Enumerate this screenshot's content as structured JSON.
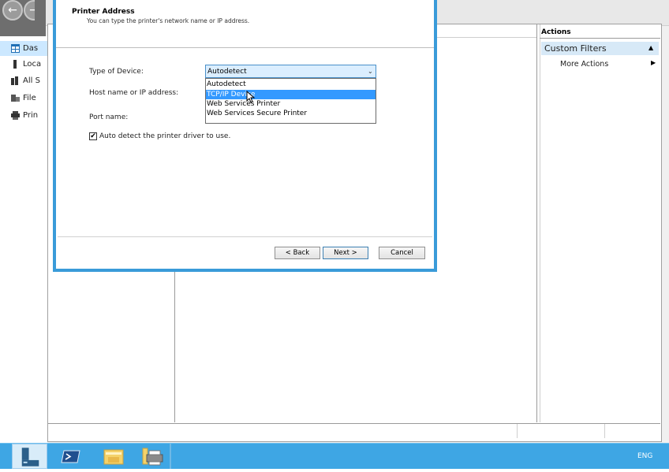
{
  "dialog": {
    "title": "Printer Address",
    "subtitle": "You can type the printer's network name or IP address.",
    "labels": {
      "device_type": "Type of Device:",
      "host": "Host name or IP address:",
      "port": "Port name:"
    },
    "device_select": {
      "value": "Autodetect",
      "options": [
        "Autodetect",
        "TCP/IP Device",
        "Web Services Printer",
        "Web Services Secure Printer"
      ],
      "highlighted": "TCP/IP Device"
    },
    "auto_detect": {
      "label": "Auto detect the printer driver to use.",
      "checked": true,
      "check_glyph": "✔"
    },
    "buttons": {
      "back": "< Back",
      "next": "Next >",
      "cancel": "Cancel"
    }
  },
  "nav": {
    "items": [
      {
        "label": "Das",
        "icon": "dashboard-icon"
      },
      {
        "label": "Loca",
        "icon": "local-server-icon"
      },
      {
        "label": "All S",
        "icon": "all-servers-icon"
      },
      {
        "label": "File",
        "icon": "file-services-icon"
      },
      {
        "label": "Prin",
        "icon": "print-services-icon"
      }
    ]
  },
  "actions": {
    "title": "Actions",
    "group": "Custom Filters",
    "more": "More Actions"
  },
  "taskbar": {
    "language": "ENG",
    "buttons": [
      "server-manager-icon",
      "powershell-icon",
      "file-explorer-icon",
      "print-management-icon"
    ]
  },
  "colors": {
    "dialog_border": "#3a9bd9",
    "taskbar": "#3ea6e4",
    "highlight": "#3399ff",
    "select_bg": "#dbeeff"
  }
}
